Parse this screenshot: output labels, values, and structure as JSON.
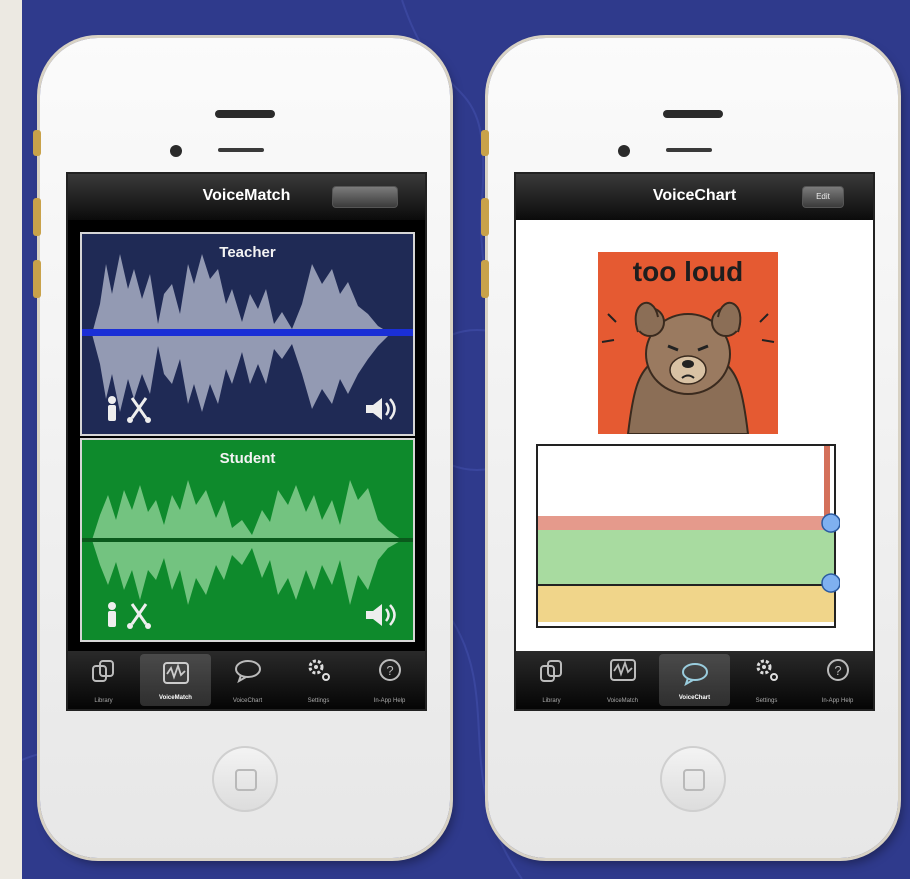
{
  "left_phone": {
    "nav_title": "VoiceMatch",
    "nav_button": "",
    "teacher_label": "Teacher",
    "student_label": "Student",
    "tabs": [
      {
        "label": "Library",
        "icon": "library-icon",
        "active": false
      },
      {
        "label": "VoiceMatch",
        "icon": "waveform-icon",
        "active": true
      },
      {
        "label": "VoiceChart",
        "icon": "speech-bubble-icon",
        "active": false
      },
      {
        "label": "Settings",
        "icon": "gear-icon",
        "active": false
      },
      {
        "label": "In-App Help",
        "icon": "help-icon",
        "active": false
      }
    ]
  },
  "right_phone": {
    "nav_title": "VoiceChart",
    "nav_button": "Edit",
    "card_text": "too loud",
    "tabs": [
      {
        "label": "Library",
        "icon": "library-icon",
        "active": false
      },
      {
        "label": "VoiceMatch",
        "icon": "waveform-icon",
        "active": false
      },
      {
        "label": "VoiceChart",
        "icon": "speech-bubble-icon",
        "active": true
      },
      {
        "label": "Settings",
        "icon": "gear-icon",
        "active": false
      },
      {
        "label": "In-App Help",
        "icon": "help-icon",
        "active": false
      }
    ]
  },
  "colors": {
    "background": "#2f3a8c",
    "teacher_panel": "#1f2a55",
    "student_panel": "#0e8a2c",
    "pitch_line": "#1a2fd6",
    "card": "#e55a32",
    "zone_red": "#e59a8c",
    "zone_green": "#a8dba0",
    "zone_yellow": "#f0d58a"
  }
}
